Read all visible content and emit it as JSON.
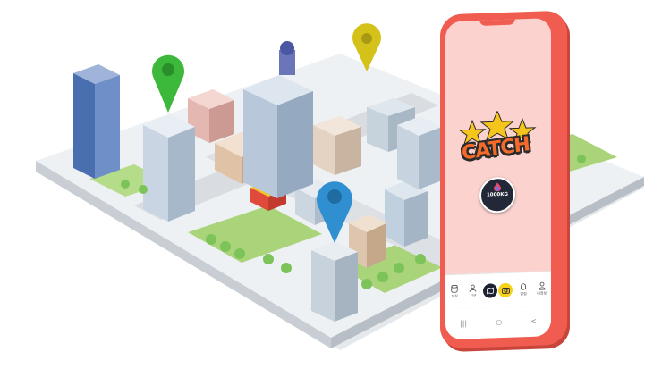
{
  "colors": {
    "phone_body": "#f05d50",
    "pin_green": "#3cb83a",
    "pin_yellow": "#d4c21a",
    "pin_blue": "#2f8fd0",
    "catch_orange": "#f36a2a",
    "star_yellow": "#f6c51b",
    "grass": "#a9d47a",
    "road": "#d9dde2"
  },
  "app": {
    "catch_label": "CATCH",
    "badge_amount": "1000KG",
    "badge_sub": "",
    "icons": {
      "badge": "flame-icon",
      "map_pin": "map-pin-icon"
    },
    "bottom_nav": [
      {
        "label": "저장",
        "icon": "database-icon"
      },
      {
        "label": "친구",
        "icon": "people-icon"
      },
      {
        "label": "",
        "icon": "map-icon"
      },
      {
        "label": "",
        "icon": "camera-icon"
      },
      {
        "label": "알림",
        "icon": "bell-icon"
      },
      {
        "label": "내정보",
        "icon": "user-icon"
      }
    ],
    "system_bar": [
      "|||",
      "○",
      "<"
    ]
  }
}
